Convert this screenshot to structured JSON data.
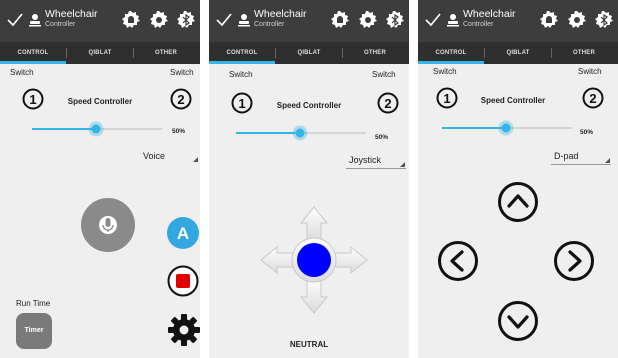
{
  "app": {
    "title": "Wheelchair",
    "subtitle": "Controller"
  },
  "tabs": [
    "CONTROL",
    "QIBLAT",
    "OTHER"
  ],
  "icons": {
    "check": "check-icon",
    "person": "person-icon",
    "bell": "bell-icon",
    "settings": "gear-icon",
    "bluetooth": "bluetooth-icon"
  },
  "colors": {
    "accent": "#33b5e5",
    "actionbar": "#3d3d3d",
    "tabs": "#2f2f2f",
    "joystick": "#0000ff",
    "stop": "#e00000"
  },
  "switch_label": "Switch",
  "switch_numbers": [
    "1",
    "2"
  ],
  "speed": {
    "label": "Speed Controller",
    "percent_text": "50%",
    "value": 0.5
  },
  "screen1": {
    "mode": "Voice",
    "mic_icon": "microphone-icon",
    "a_button": "A",
    "run_time_label": "Run Time",
    "timer_label": "Timer"
  },
  "screen2": {
    "mode": "Joystick",
    "status": "NEUTRAL"
  },
  "screen3": {
    "mode": "D-pad"
  }
}
